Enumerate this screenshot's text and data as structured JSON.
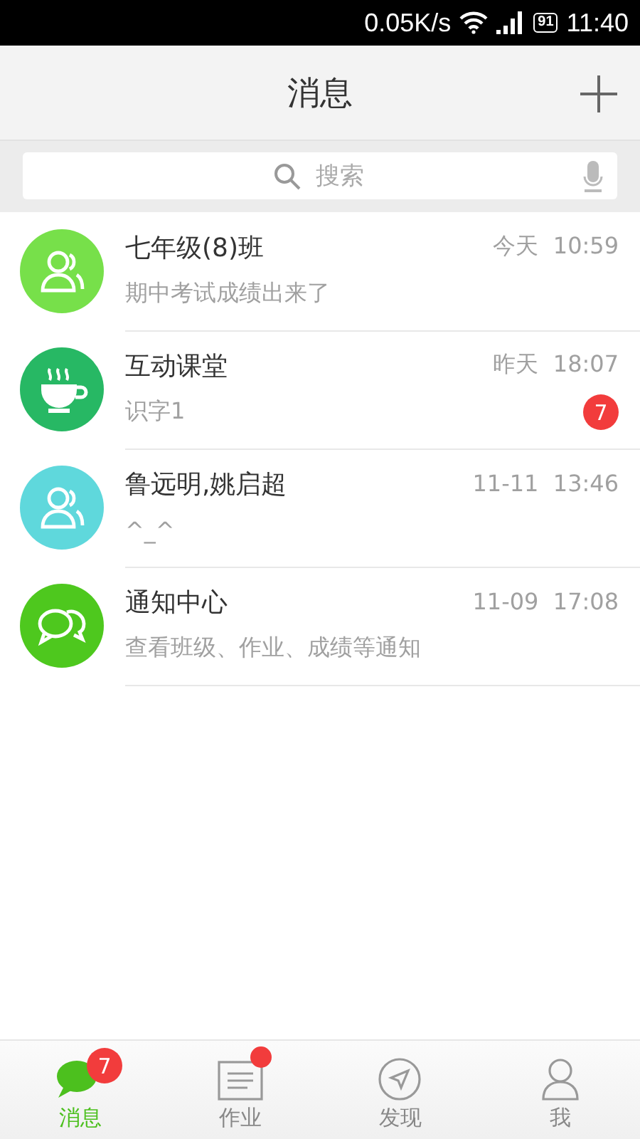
{
  "status_bar": {
    "speed": "0.05K/s",
    "battery": "91",
    "time": "11:40"
  },
  "header": {
    "title": "消息"
  },
  "search": {
    "placeholder": "搜索"
  },
  "conversations": [
    {
      "name": "七年级(8)班",
      "time": "今天  10:59",
      "preview": "期中考试成绩出来了",
      "kind": "group",
      "color": "#77e04a"
    },
    {
      "name": "互动课堂",
      "time": "昨天  18:07",
      "preview": "识字1",
      "kind": "cup",
      "color": "#27b864",
      "badge": "7"
    },
    {
      "name": "鲁远明,姚启超",
      "time": "11-11  13:46",
      "preview": "^_^",
      "kind": "group",
      "color": "#5fd8dc"
    },
    {
      "name": "通知中心",
      "time": "11-09  17:08",
      "preview": "查看班级、作业、成绩等通知",
      "kind": "chat",
      "color": "#4ec81e"
    }
  ],
  "tabs": [
    {
      "label": "消息",
      "kind": "chat",
      "selected": true,
      "badge": "7"
    },
    {
      "label": "作业",
      "kind": "doc",
      "selected": false,
      "dot": true
    },
    {
      "label": "发现",
      "kind": "compass",
      "selected": false
    },
    {
      "label": "我",
      "kind": "person",
      "selected": false
    }
  ]
}
